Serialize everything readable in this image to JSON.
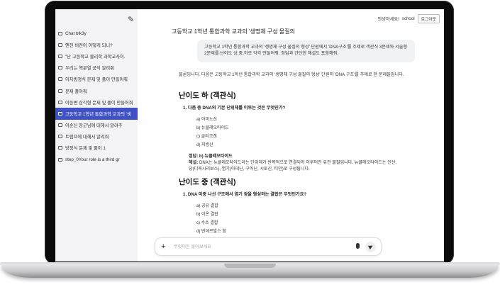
{
  "sidebar": {
    "items": [
      {
        "label": "Chat blk3y"
      },
      {
        "label": "엔진 버전이 어떻게 되니?"
      },
      {
        "label": "\"난 고등학교 물리학 과학교사이."
      },
      {
        "label": "우리는 핵분열 공식 알려줘"
      },
      {
        "label": "이차방정식 문제 및 풀이 만들어줘"
      },
      {
        "label": "문제 풀어줘"
      },
      {
        "label": "이등변 삼각형 문제 및 풀이 만들어줘"
      },
      {
        "label": "고등학교 1학년 통합과학 교과의 '생"
      },
      {
        "label": "이순신 장군님에 대해서 알려주"
      },
      {
        "label": "트럼프에 대해서 알려줘"
      },
      {
        "label": "방정식 문제 및 풀이 1"
      },
      {
        "label": "step_0Your role is a third gr"
      }
    ],
    "active_index": 7
  },
  "header": {
    "greeting": "안녕하세요!",
    "username": "school",
    "logout_label": "로그아웃"
  },
  "chat": {
    "title": "고등학교 1학년 통합과학 교과의 '생명체 구성 물질의",
    "user_message": "고등학교 1학년 통합과학 교과의 '생명체 구성 물질의 형성' 단원에서 'DNA구조'를 주제로 객관식 3문제와 서술형 2문제를 난이도 상,중,하로 각각 만들어줘. 정답과 간단한 해설도 포함해줘.",
    "intro": "물론입니다. 다음은 고등학교 1학년 통합과학 교과의 '생명체 구성 물질의 형성' 단원의 'DNA 구조'를 주제로 한 문제들입니다.",
    "section1": {
      "heading": "난이도 하 (객관식)",
      "question": "1. 다음 중 DNA의 기본 단위체를 이루는 것은 무엇인가?",
      "options": [
        "a) 아미노산",
        "b) 뉴클레오타이드",
        "c) 글리코겐",
        "d) 지방산"
      ],
      "answer": "정답: b) 뉴클레오타이드",
      "explanation_label": "해설:",
      "explanation": "DNA는 뉴클레오타이드라는 단위체가 반복적으로 연결되어 이루어진 유전 물질입니다. 뉴클레오타이드는 인산, 당(디옥시리보스), 염기(아데닌, 구아닌, 시토신, 티민)로 구성됩니다."
    },
    "section2": {
      "heading": "난이도 중 (객관식)",
      "question": "1. DNA 이중 나선 구조에서 염기 쌍을 형성하는 결합은 무엇인가요?",
      "options": [
        "a) 공유 결합",
        "b) 이온 결합",
        "c) 수소 결합",
        "d) 반데르발스 힘"
      ]
    }
  },
  "input": {
    "placeholder": "무엇이든 물어보세요"
  }
}
